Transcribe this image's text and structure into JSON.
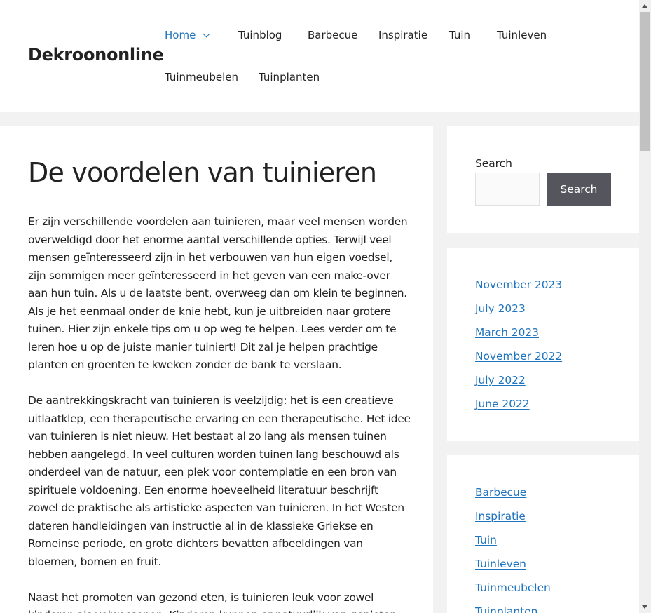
{
  "site": {
    "title": "Dekroononline"
  },
  "nav": {
    "items": [
      {
        "label": "Home"
      },
      {
        "label": "Tuinblog"
      },
      {
        "label": "Barbecue"
      },
      {
        "label": "Inspiratie"
      },
      {
        "label": "Tuin"
      },
      {
        "label": "Tuinleven"
      },
      {
        "label": "Tuinmeubelen"
      },
      {
        "label": "Tuinplanten"
      }
    ]
  },
  "article": {
    "title": "De voordelen van tuinieren",
    "paragraphs": [
      "Er zijn verschillende voordelen aan tuinieren, maar veel mensen worden overweldigd door het enorme aantal verschillende opties. Terwijl veel mensen geïnteresseerd zijn in het verbouwen van hun eigen voedsel, zijn sommigen meer geïnteresseerd in het geven van een make-over aan hun tuin. Als u de laatste bent, overweeg dan om klein te beginnen. Als je het eenmaal onder de knie hebt, kun je uitbreiden naar grotere tuinen. Hier zijn enkele tips om u op weg te helpen. Lees verder om te leren hoe u op de juiste manier tuiniert! Dit zal je helpen prachtige planten en groenten te kweken zonder de bank te verslaan.",
      "De aantrekkingskracht van tuinieren is veelzijdig: het is een creatieve uitlaatklep, een therapeutische ervaring en een therapeutische. Het idee van tuinieren is niet nieuw. Het bestaat al zo lang als mensen tuinen hebben aangelegd. In veel culturen worden tuinen lang beschouwd als onderdeel van de natuur, een plek voor contemplatie en een bron van spirituele voldoening. Een enorme hoeveelheid literatuur beschrijft zowel de praktische als artistieke aspecten van tuinieren. In het Westen dateren handleidingen van instructie al in de klassieke Griekse en Romeinse periode, en grote dichters bevatten afbeeldingen van bloemen, bomen en fruit.",
      "Naast het promoten van gezond eten, is tuinieren leuk voor zowel kinderen als volwassenen. Kinderen kunnen er natuurlijk van genieten"
    ]
  },
  "search": {
    "label": "Search",
    "value": "",
    "placeholder": "",
    "button_label": "Search"
  },
  "archives": {
    "items": [
      "November 2023",
      "July 2023",
      "March 2023",
      "November 2022",
      "July 2022",
      "June 2022"
    ]
  },
  "categories": {
    "items": [
      "Barbecue",
      "Inspiratie",
      "Tuin",
      "Tuinleven",
      "Tuinmeubelen",
      "Tuinplanten"
    ]
  },
  "colors": {
    "link": "#1e73be",
    "text": "#222222",
    "button_bg": "#55555e",
    "page_bg": "#f2f2f2"
  }
}
